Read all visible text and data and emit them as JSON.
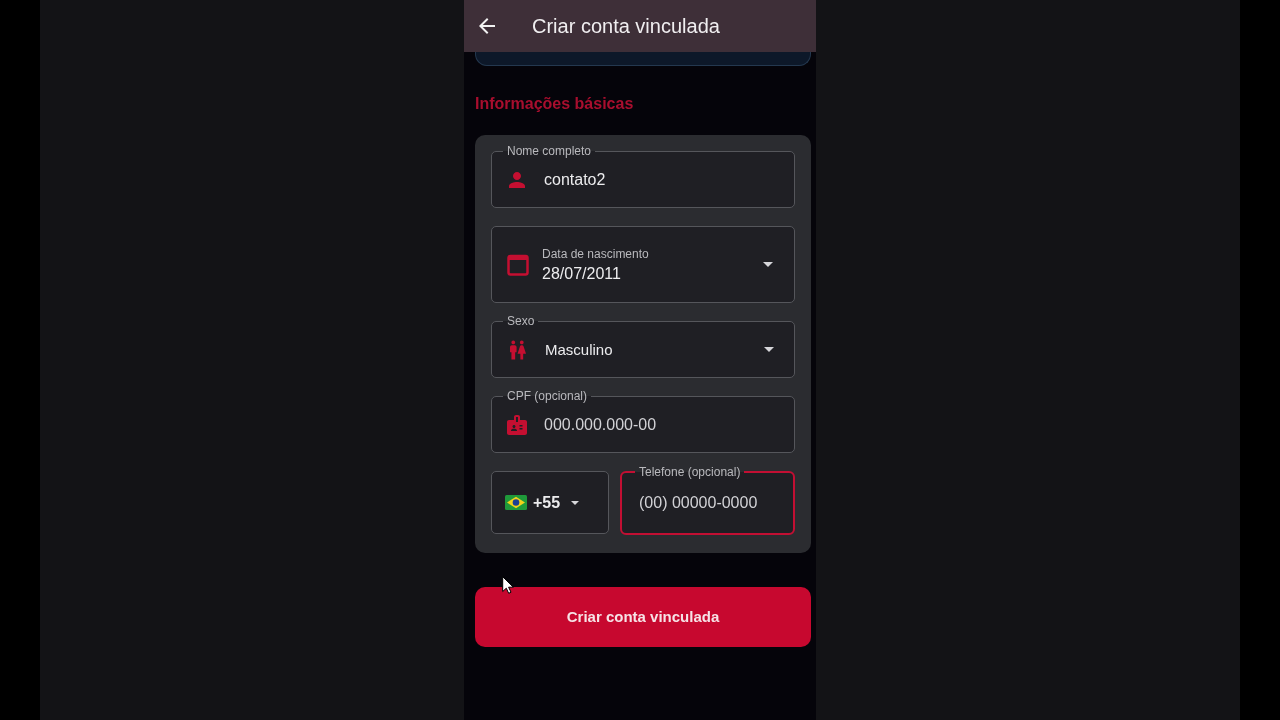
{
  "app_bar": {
    "title": "Criar conta vinculada"
  },
  "section_title": "Informações básicas",
  "fields": [
    {
      "kind": "text",
      "label": "Nome completo",
      "value": "contato2",
      "focused": false
    },
    {
      "kind": "date",
      "label": "Data de nascimento",
      "value": "28/07/2011",
      "focused": false
    },
    {
      "kind": "select",
      "label": "Sexo",
      "value": "Masculino",
      "focused": false
    },
    {
      "kind": "text",
      "label": "CPF (opcional)",
      "placeholder": "000.000.000-00",
      "focused": false
    },
    {
      "kind": "phone",
      "country_code": "+55",
      "label": "Telefone (opcional)",
      "placeholder": "(00) 00000-0000",
      "focused": true
    }
  ],
  "submit_button": "Criar conta vinculada"
}
